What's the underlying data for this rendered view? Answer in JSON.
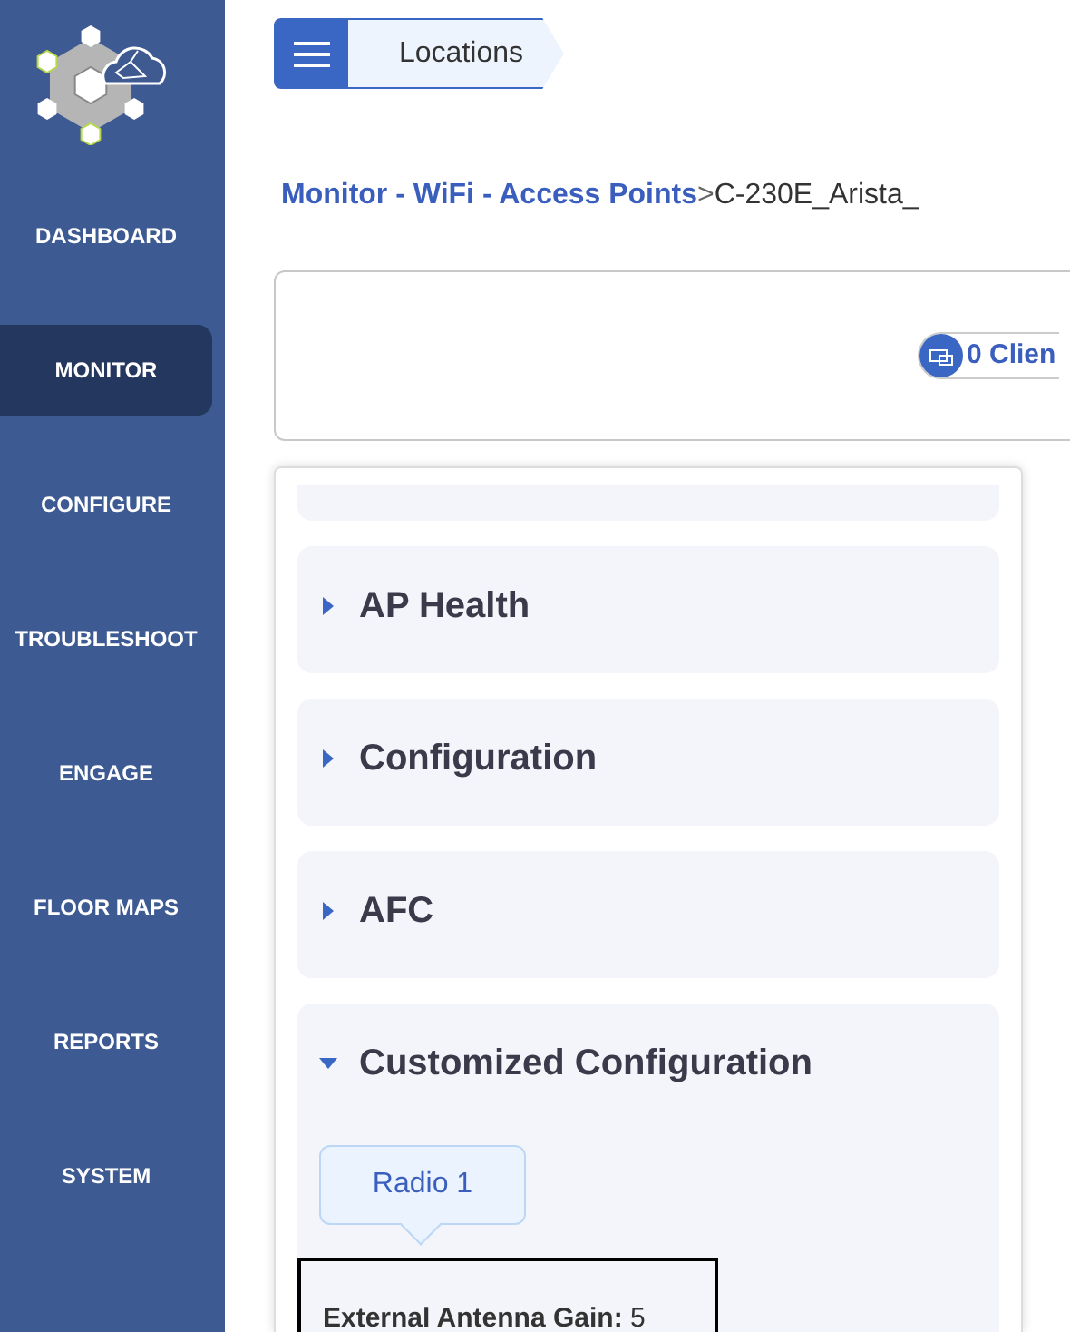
{
  "sidebar": {
    "items": [
      {
        "label": "DASHBOARD",
        "selected": false
      },
      {
        "label": "MONITOR",
        "selected": true
      },
      {
        "label": "CONFIGURE",
        "selected": false
      },
      {
        "label": "TROUBLESHOOT",
        "selected": false
      },
      {
        "label": "ENGAGE",
        "selected": false
      },
      {
        "label": "FLOOR MAPS",
        "selected": false
      },
      {
        "label": "REPORTS",
        "selected": false
      },
      {
        "label": "SYSTEM",
        "selected": false
      }
    ]
  },
  "location_button": {
    "label": "Locations"
  },
  "breadcrumb": {
    "path": "Monitor - WiFi - Access Points",
    "separator": ">",
    "current": "C-230E_Arista_"
  },
  "summary": {
    "clients": "0 Clien"
  },
  "sections": [
    {
      "title": "AP Health",
      "expanded": false
    },
    {
      "title": "Configuration",
      "expanded": false
    },
    {
      "title": "AFC",
      "expanded": false
    },
    {
      "title": "Customized Configuration",
      "expanded": true,
      "tabs": [
        {
          "label": "Radio 1",
          "selected": true
        }
      ],
      "fields": [
        {
          "label": "External Antenna Gain:",
          "value": "5"
        }
      ]
    }
  ]
}
